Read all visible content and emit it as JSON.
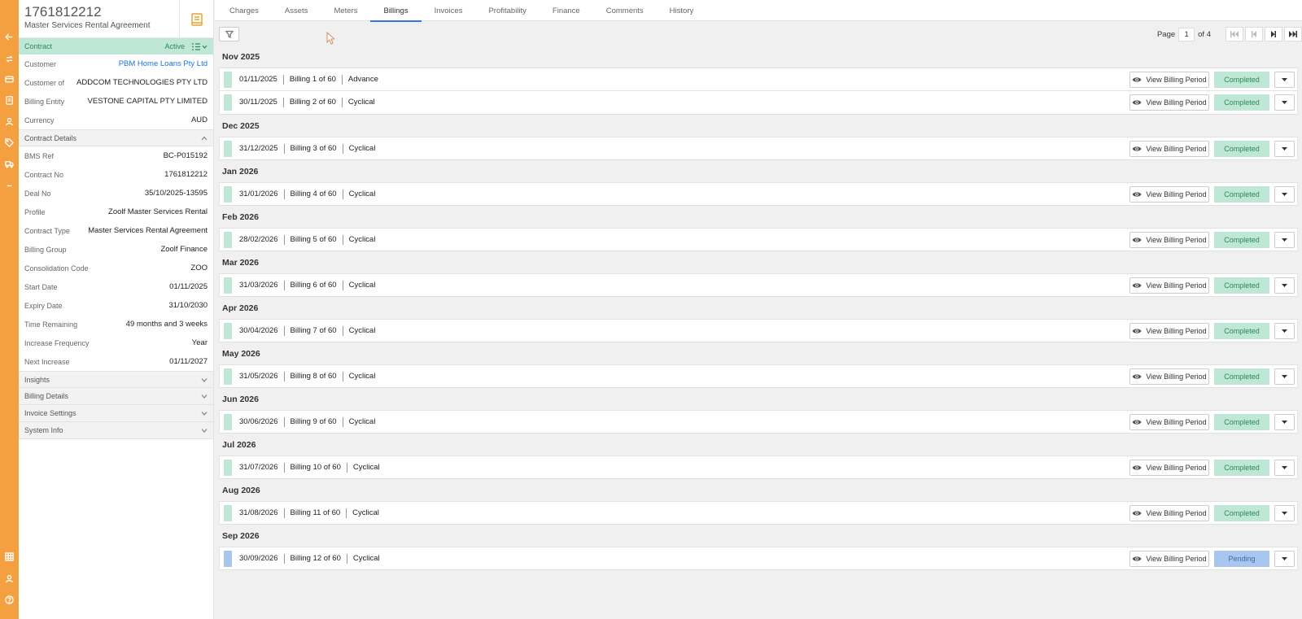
{
  "rail_icons": [
    "back-arrow-icon",
    "exchange-icon",
    "card-icon",
    "document-icon",
    "user-icon",
    "tag-icon",
    "truck-icon",
    "more-icon",
    "grid-icon",
    "person-icon",
    "help-icon"
  ],
  "header": {
    "contract_number": "1761812212",
    "contract_title": "Master Services Rental Agreement"
  },
  "contract_bar": {
    "label": "Contract",
    "status": "Active"
  },
  "summary": [
    {
      "label": "Customer",
      "value": "PBM Home Loans Pty Ltd",
      "link": true
    },
    {
      "label": "Customer of",
      "value": "ADDCOM TECHNOLOGIES PTY LTD"
    },
    {
      "label": "Billing Entity",
      "value": "VESTONE CAPITAL PTY LIMITED"
    },
    {
      "label": "Currency",
      "value": "AUD"
    }
  ],
  "contract_details": {
    "title": "Contract Details",
    "rows": [
      {
        "label": "BMS Ref",
        "value": "BC-P015192"
      },
      {
        "label": "Contract No",
        "value": "1761812212"
      },
      {
        "label": "Deal No",
        "value": "35/10/2025-13595"
      },
      {
        "label": "Profile",
        "value": "Zoolf Master Services Rental"
      },
      {
        "label": "Contract Type",
        "value": "Master Services Rental Agreement"
      },
      {
        "label": "Billing Group",
        "value": "Zoolf Finance"
      },
      {
        "label": "Consolidation Code",
        "value": "ZOO"
      },
      {
        "label": "Start Date",
        "value": "01/11/2025"
      },
      {
        "label": "Expiry Date",
        "value": "31/10/2030"
      },
      {
        "label": "Time Remaining",
        "value": "49 months and 3 weeks"
      },
      {
        "label": "Increase Frequency",
        "value": "Year"
      },
      {
        "label": "Next Increase",
        "value": "01/11/2027"
      }
    ]
  },
  "collapsed_sections": [
    "Insights",
    "Billing Details",
    "Invoice Settings",
    "System Info"
  ],
  "tabs": [
    {
      "label": "Charges"
    },
    {
      "label": "Assets"
    },
    {
      "label": "Meters"
    },
    {
      "label": "Billings",
      "active": true
    },
    {
      "label": "Invoices"
    },
    {
      "label": "Profitability"
    },
    {
      "label": "Finance"
    },
    {
      "label": "Comments"
    },
    {
      "label": "History"
    }
  ],
  "pager": {
    "page_label": "Page",
    "current": "1",
    "of_label": "of 4"
  },
  "view_label": "View Billing Period",
  "colors": {
    "completed": "#bfe7d5",
    "pending": "#a9c6ef",
    "rail": "#f5a040",
    "accent": "#2f7ad8"
  },
  "months": [
    {
      "month": "Nov 2025",
      "billings": [
        {
          "date": "01/11/2025",
          "seq": "Billing 1 of 60",
          "type": "Advance",
          "status": "Completed"
        },
        {
          "date": "30/11/2025",
          "seq": "Billing 2 of 60",
          "type": "Cyclical",
          "status": "Completed"
        }
      ]
    },
    {
      "month": "Dec 2025",
      "billings": [
        {
          "date": "31/12/2025",
          "seq": "Billing 3 of 60",
          "type": "Cyclical",
          "status": "Completed"
        }
      ]
    },
    {
      "month": "Jan 2026",
      "billings": [
        {
          "date": "31/01/2026",
          "seq": "Billing 4 of 60",
          "type": "Cyclical",
          "status": "Completed"
        }
      ]
    },
    {
      "month": "Feb 2026",
      "billings": [
        {
          "date": "28/02/2026",
          "seq": "Billing 5 of 60",
          "type": "Cyclical",
          "status": "Completed"
        }
      ]
    },
    {
      "month": "Mar 2026",
      "billings": [
        {
          "date": "31/03/2026",
          "seq": "Billing 6 of 60",
          "type": "Cyclical",
          "status": "Completed"
        }
      ]
    },
    {
      "month": "Apr 2026",
      "billings": [
        {
          "date": "30/04/2026",
          "seq": "Billing 7 of 60",
          "type": "Cyclical",
          "status": "Completed"
        }
      ]
    },
    {
      "month": "May 2026",
      "billings": [
        {
          "date": "31/05/2026",
          "seq": "Billing 8 of 60",
          "type": "Cyclical",
          "status": "Completed"
        }
      ]
    },
    {
      "month": "Jun 2026",
      "billings": [
        {
          "date": "30/06/2026",
          "seq": "Billing 9 of 60",
          "type": "Cyclical",
          "status": "Completed"
        }
      ]
    },
    {
      "month": "Jul 2026",
      "billings": [
        {
          "date": "31/07/2026",
          "seq": "Billing 10 of 60",
          "type": "Cyclical",
          "status": "Completed"
        }
      ]
    },
    {
      "month": "Aug 2026",
      "billings": [
        {
          "date": "31/08/2026",
          "seq": "Billing 11 of 60",
          "type": "Cyclical",
          "status": "Completed"
        }
      ]
    },
    {
      "month": "Sep 2026",
      "billings": [
        {
          "date": "30/09/2026",
          "seq": "Billing 12 of 60",
          "type": "Cyclical",
          "status": "Pending"
        }
      ]
    }
  ]
}
